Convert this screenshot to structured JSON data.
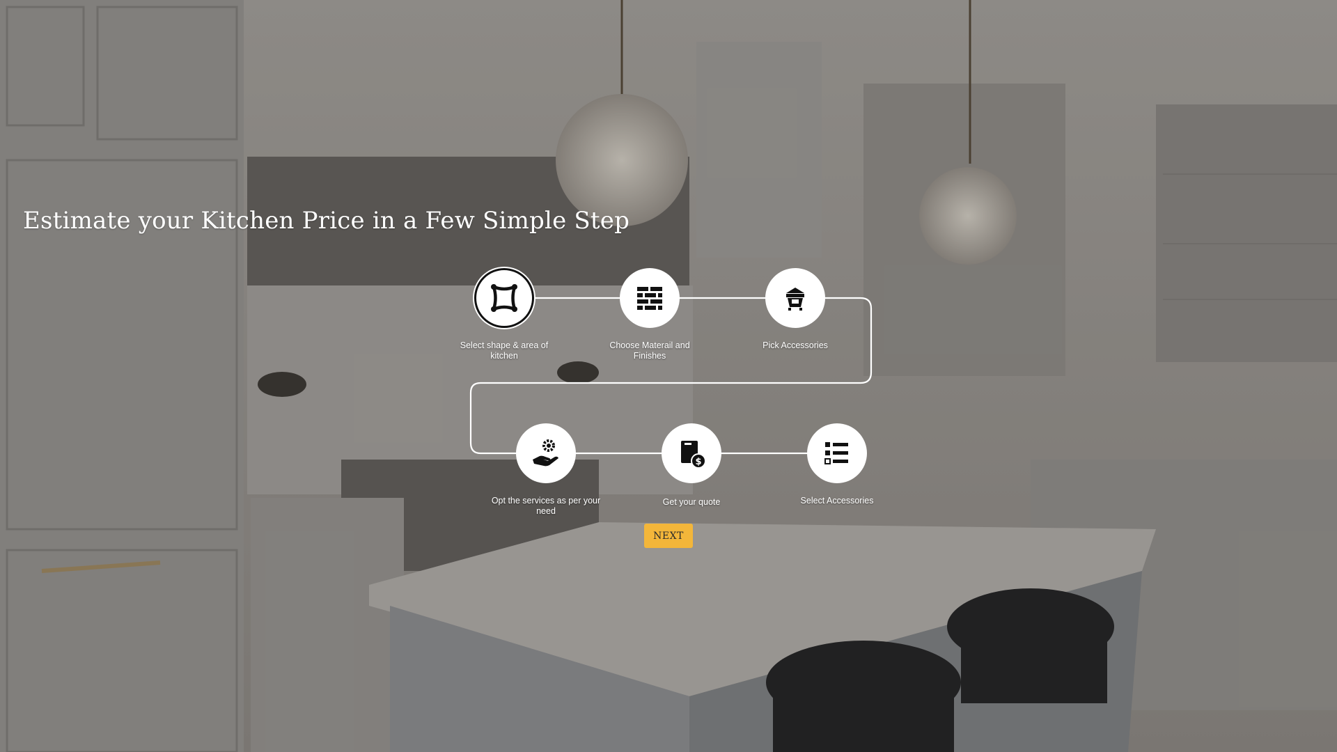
{
  "page": {
    "headline": "Estimate your Kitchen Price in a Few Simple Step",
    "accent_color": "#f3b63a"
  },
  "steps": [
    {
      "label": "Select shape & area of kitchen",
      "icon": "kitchen-shape-icon",
      "selected": true
    },
    {
      "label": "Choose Materail and Finishes",
      "icon": "brick-wall-icon",
      "selected": false
    },
    {
      "label": "Pick Accessories",
      "icon": "accessory-box-icon",
      "selected": false
    },
    {
      "label": "Opt the services as per your need",
      "icon": "service-hand-gear-icon",
      "selected": false
    },
    {
      "label": "Get your quote",
      "icon": "quote-price-icon",
      "selected": false
    },
    {
      "label": "Select Accessories",
      "icon": "checklist-icon",
      "selected": false
    }
  ],
  "next_button": {
    "label": "NEXT"
  }
}
